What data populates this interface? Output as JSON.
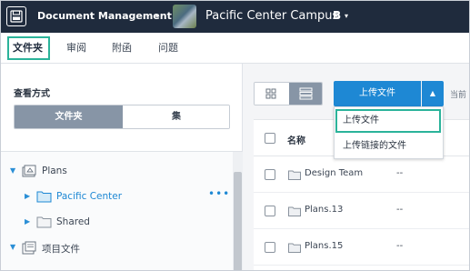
{
  "topbar": {
    "app_name": "Document Management",
    "project_name": "Pacific Center Campus",
    "project_logo": "B",
    "caret": "▾"
  },
  "tabs": [
    "文件夹",
    "审阅",
    "附函",
    "问题"
  ],
  "left": {
    "view_title": "查看方式",
    "segments": [
      "文件夹",
      "集"
    ],
    "tree": [
      {
        "label": "Plans",
        "expanded": true
      },
      {
        "label": "Pacific Center",
        "selected": true,
        "more": "•••"
      },
      {
        "label": "Shared"
      },
      {
        "label": "项目文件",
        "expanded": true
      }
    ]
  },
  "right": {
    "upload_label": "上传文件",
    "current_text": "当前",
    "table_header": "名称",
    "rows": [
      {
        "name": "Design Team",
        "value": "--"
      },
      {
        "name": "Plans.13",
        "value": "--"
      },
      {
        "name": "Plans.15",
        "value": "--"
      }
    ]
  },
  "dropdown": {
    "items": [
      "上传文件",
      "上传链接的文件"
    ]
  },
  "colors": {
    "topbar": "#1f2b3d",
    "accent_blue": "#1e88d4",
    "highlight_teal": "#2bb39a",
    "segment_active": "#8795a6"
  },
  "icons": {
    "app": "document-management-icon",
    "grid_view": "grid-view-icon",
    "list_view": "list-view-icon",
    "folder": "folder-icon",
    "plans": "plans-folder-icon",
    "project_files": "project-files-icon"
  }
}
